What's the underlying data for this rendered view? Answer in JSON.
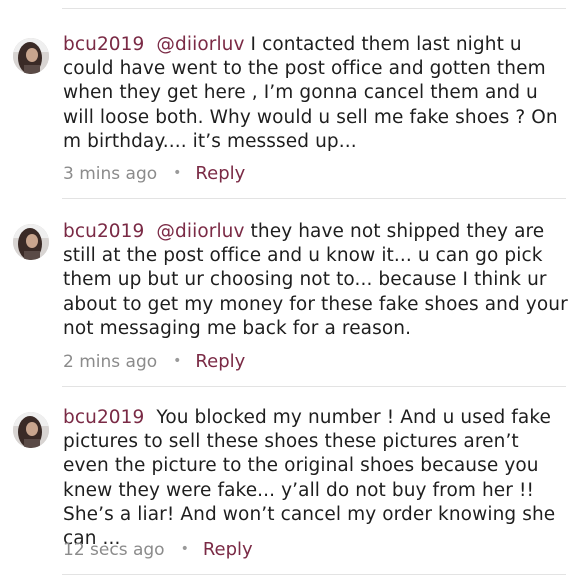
{
  "comments": [
    {
      "username": "bcu2019",
      "mention": "@diiorluv",
      "text": "I contacted them last night u could have went to the post office and gotten them when they get here , I’m gonna cancel them and u will loose both. Why would u sell me fake shoes ? On m birthday.... it’s messsed up...",
      "time": "3 mins ago",
      "reply_label": "Reply",
      "avatar_icon": "user-avatar"
    },
    {
      "username": "bcu2019",
      "mention": "@diiorluv",
      "text": "they have not shipped they are still at the post office and u know it... u can go pick them up but ur choosing not to... because I think ur about to get my money for these fake shoes and your not messaging me back for a reason.",
      "time": "2 mins ago",
      "reply_label": "Reply",
      "avatar_icon": "user-avatar"
    },
    {
      "username": "bcu2019",
      "mention": "",
      "text": "You blocked my number ! And u used fake pictures to sell these shoes these pictures aren’t even the picture to the original shoes because you knew they were fake... y’all do not buy from her !! She’s a liar! And won’t cancel my order knowing she can ...",
      "time": "12 secs ago",
      "reply_label": "Reply",
      "avatar_icon": "user-avatar"
    }
  ],
  "separator": "•",
  "colors": {
    "accent": "#7a2a45",
    "meta": "#8b8b8b",
    "divider": "#e3e3e3"
  }
}
